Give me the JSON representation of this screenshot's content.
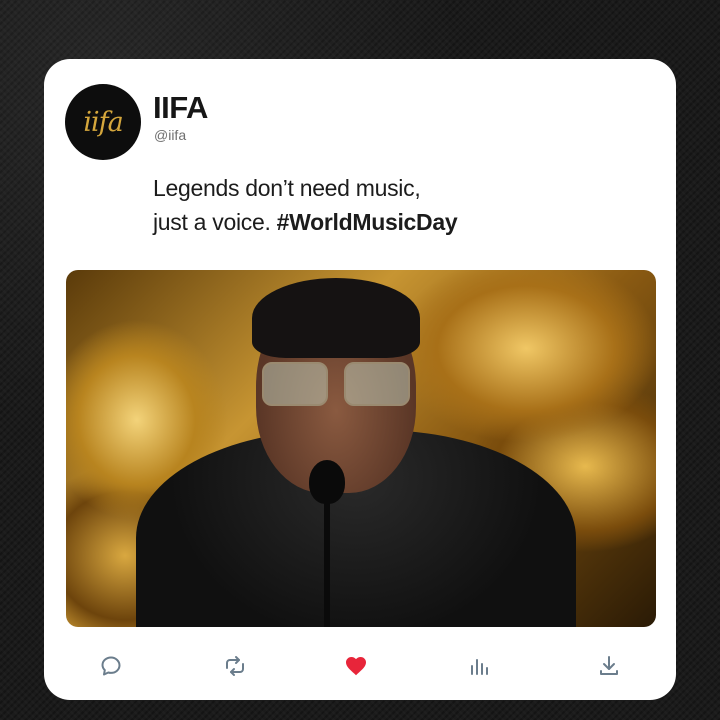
{
  "post": {
    "display_name": "IIFA",
    "handle": "@iifa",
    "avatar_logo": "iifa",
    "text_line1": "Legends don’t need music,",
    "text_line2_prefix": "just a voice.",
    "hashtag": "#WorldMusicDay",
    "media_icon": "photo-of-performer-at-microphone"
  },
  "actions": [
    {
      "icon": "comment-icon"
    },
    {
      "icon": "retweet-icon"
    },
    {
      "icon": "heart-icon",
      "active": true,
      "color": "#e8253a"
    },
    {
      "icon": "analytics-icon"
    },
    {
      "icon": "share-icon"
    }
  ],
  "colors": {
    "background": "#1b1b1b",
    "card": "#ffffff",
    "heart": "#e8253a",
    "icon": "#6b7d8c",
    "logo_gold": "#d4a63c"
  }
}
